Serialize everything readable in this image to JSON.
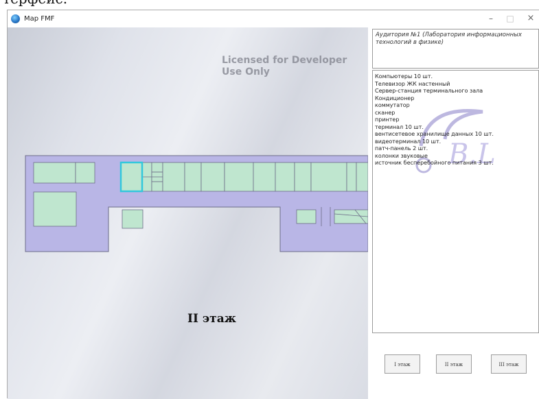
{
  "window": {
    "title": "Map FMF"
  },
  "controls": {
    "minimize": "–",
    "maximize": "□",
    "close": "×"
  },
  "map": {
    "license_line1": "Licensed for Developer",
    "license_line2": "Use Only",
    "floor_label": "II этаж"
  },
  "info": {
    "room_title": "Аудитория №1 (Лаборатория информационных технологий в физике)",
    "equipment": [
      "Компьютеры 10 шт.",
      "Телевизор ЖК настенный",
      "Сервер-станция терминального зала",
      "Кондиционер",
      "коммутатор",
      "сканер",
      "принтер",
      "терминал 10 шт.",
      "вентисетевое хранилище данных 10 шт.",
      "видеотерминал 10 шт.",
      "патч-панель 2 шт.",
      "колонки звуковые",
      "источник бесперебойного питания 3 шт."
    ]
  },
  "floor_buttons": [
    "I этаж",
    "II этаж",
    "III этаж"
  ],
  "colors": {
    "corridor": "#b9b6e6",
    "room": "#bfe6cf",
    "selected": "#32c8dc",
    "outline": "#6c6c88"
  }
}
